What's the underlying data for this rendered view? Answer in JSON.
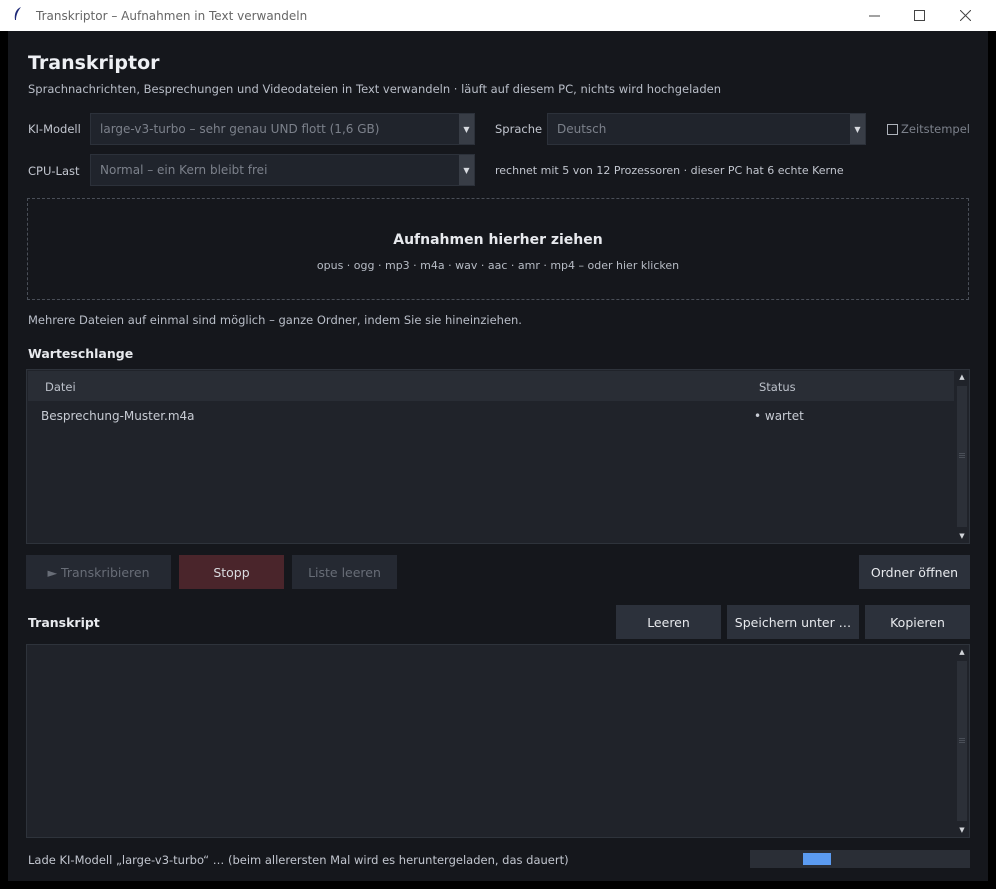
{
  "window": {
    "title": "Transkriptor  –  Aufnahmen in Text verwandeln",
    "controls": {
      "minimize": "—",
      "maximize": "☐",
      "close": "✕"
    }
  },
  "header": {
    "title": "Transkriptor",
    "subtitle": "Sprachnachrichten, Besprechungen und Videodateien in Text verwandeln  ·  läuft auf diesem PC, nichts wird hochgeladen"
  },
  "settings": {
    "model_label": "KI-Modell",
    "model_value": "large-v3-turbo  –  sehr genau UND flott  (1,6 GB)",
    "language_label": "Sprache",
    "language_value": "Deutsch",
    "timestamps_label": "Zeitstempel",
    "timestamps_checked": false,
    "cpu_label": "CPU-Last",
    "cpu_value": "Normal  –  ein Kern bleibt frei",
    "cpu_info": "rechnet mit 5 von 12 Prozessoren  ·  dieser PC hat 6 echte Kerne"
  },
  "dropzone": {
    "title": "Aufnahmen hierher ziehen",
    "formats": "opus  ·  ogg  ·  mp3  ·  m4a  ·  wav  ·  aac  ·  amr  ·  mp4     –  oder hier klicken"
  },
  "hint": "Mehrere Dateien auf einmal sind möglich – ganze Ordner, indem Sie sie hineinziehen.",
  "queue": {
    "heading": "Warteschlange",
    "columns": {
      "file": "Datei",
      "status": "Status"
    },
    "rows": [
      {
        "file": "Besprechung-Muster.m4a",
        "status": "• wartet"
      }
    ]
  },
  "actions": {
    "transcribe": "►  Transkribieren",
    "stop": "Stopp",
    "clear_list": "Liste leeren",
    "open_folder": "Ordner öffnen"
  },
  "transcript": {
    "heading": "Transkript",
    "clear": "Leeren",
    "save_as": "Speichern unter …",
    "copy": "Kopieren",
    "text": ""
  },
  "status": {
    "text": "Lade KI-Modell „large-v3-turbo“ … (beim allerersten Mal wird es heruntergeladen, das dauert)"
  },
  "colors": {
    "background": "#15171c",
    "panel": "#20232a",
    "accent": "#5b9bf1",
    "stop_button": "#4a252b"
  },
  "icons": {
    "app": "feather-icon",
    "dropdown": "chevron-down-icon",
    "scroll_up": "arrow-up-icon",
    "scroll_down": "arrow-down-icon"
  }
}
